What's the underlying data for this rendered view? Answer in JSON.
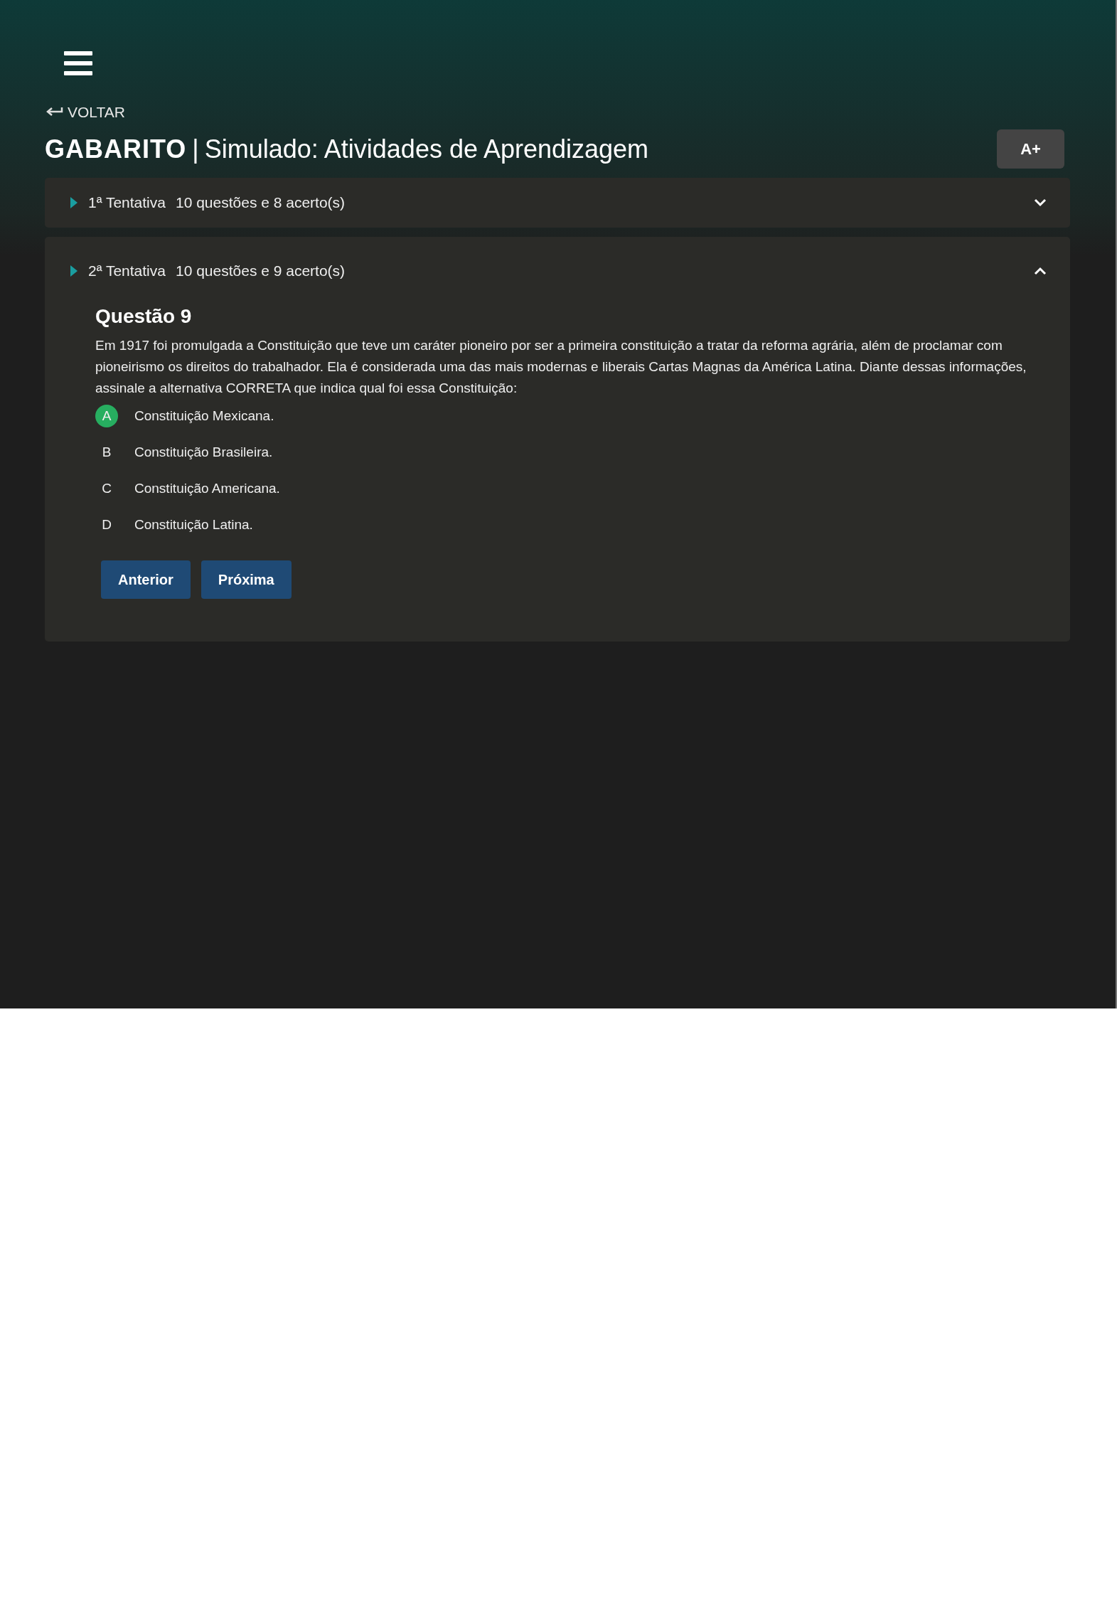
{
  "back_link": "VOLTAR",
  "title": {
    "label": "GABARITO",
    "separator": "|",
    "name": "Simulado: Atividades de Aprendizagem"
  },
  "font_button": "A+",
  "attempts": [
    {
      "name": "1ª Tentativa",
      "summary": "10 questões e 8 acerto(s)",
      "expanded": false
    },
    {
      "name": "2ª Tentativa",
      "summary": "10 questões e 9 acerto(s)",
      "expanded": true
    }
  ],
  "question": {
    "title": "Questão 9",
    "text": "Em 1917 foi promulgada a Constituição que teve um caráter pioneiro por ser a primeira constituição a tratar da reforma agrária, além de proclamar com pioneirismo os direitos do trabalhador. Ela é considerada uma das mais modernas e liberais Cartas Magnas da América Latina. Diante dessas informações, assinale a alternativa CORRETA que indica qual foi essa Constituição:",
    "options": [
      {
        "letter": "A",
        "text": "Constituição Mexicana.",
        "correct": true
      },
      {
        "letter": "B",
        "text": "Constituição Brasileira.",
        "correct": false
      },
      {
        "letter": "C",
        "text": "Constituição Americana.",
        "correct": false
      },
      {
        "letter": "D",
        "text": "Constituição Latina.",
        "correct": false
      }
    ]
  },
  "buttons": [
    "Anterior",
    "Próxima"
  ]
}
